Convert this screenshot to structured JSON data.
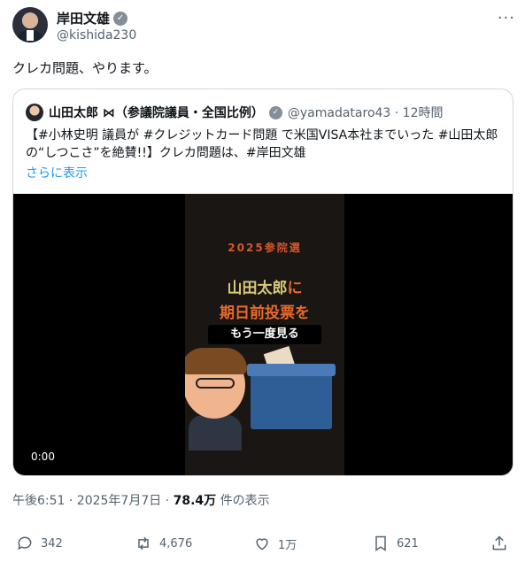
{
  "author": {
    "name": "岸田文雄",
    "handle": "@kishida230",
    "verified_badge": "✓",
    "more_label": "···"
  },
  "tweet": {
    "text": "クレカ問題、やります。"
  },
  "quote": {
    "name": "山田太郎 ⋈（参議院議員・全国比例）",
    "verified_badge": "✓",
    "handle_time": "@yamadataro43 · 12時間",
    "text": "【#小林史明 議員が #クレジットカード問題 で米国VISA本社までいった #山田太郎 の“しつこさ”を絶賛!!】クレカ問題は、#岸田文雄",
    "show_more": "さらに表示"
  },
  "video": {
    "year": "2025参院選",
    "line1_a": "山田太郎",
    "line1_b": "に",
    "line2": "期日前投票を",
    "replay": "もう一度見る",
    "time": "0:00"
  },
  "meta": {
    "time_date": "午後6:51 · 2025年7月7日 · ",
    "views_count": "78.4万",
    "views_label": " 件の表示"
  },
  "actions": {
    "replies": "342",
    "reposts": "4,676",
    "likes": "1万",
    "bookmarks": "621"
  }
}
